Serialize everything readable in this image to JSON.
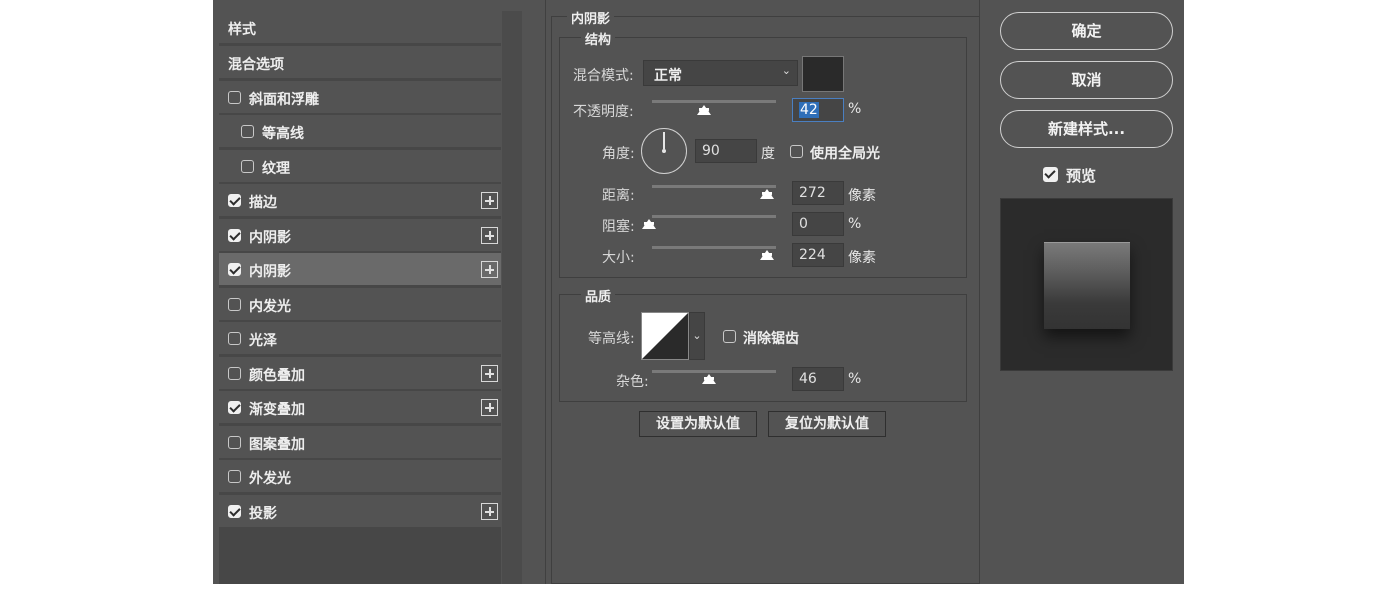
{
  "style_list": {
    "items": [
      {
        "label": "样式",
        "has_checkbox": false,
        "checked": false,
        "has_plus": false,
        "selected": false,
        "indent": false
      },
      {
        "label": "混合选项",
        "has_checkbox": false,
        "checked": false,
        "has_plus": false,
        "selected": false,
        "indent": false
      },
      {
        "label": "斜面和浮雕",
        "has_checkbox": true,
        "checked": false,
        "has_plus": false,
        "selected": false,
        "indent": false
      },
      {
        "label": "等高线",
        "has_checkbox": true,
        "checked": false,
        "has_plus": false,
        "selected": false,
        "indent": true
      },
      {
        "label": "纹理",
        "has_checkbox": true,
        "checked": false,
        "has_plus": false,
        "selected": false,
        "indent": true
      },
      {
        "label": "描边",
        "has_checkbox": true,
        "checked": true,
        "has_plus": true,
        "selected": false,
        "indent": false
      },
      {
        "label": "内阴影",
        "has_checkbox": true,
        "checked": true,
        "has_plus": true,
        "selected": false,
        "indent": false
      },
      {
        "label": "内阴影",
        "has_checkbox": true,
        "checked": true,
        "has_plus": true,
        "selected": true,
        "indent": false
      },
      {
        "label": "内发光",
        "has_checkbox": true,
        "checked": false,
        "has_plus": false,
        "selected": false,
        "indent": false
      },
      {
        "label": "光泽",
        "has_checkbox": true,
        "checked": false,
        "has_plus": false,
        "selected": false,
        "indent": false
      },
      {
        "label": "颜色叠加",
        "has_checkbox": true,
        "checked": false,
        "has_plus": true,
        "selected": false,
        "indent": false
      },
      {
        "label": "渐变叠加",
        "has_checkbox": true,
        "checked": true,
        "has_plus": true,
        "selected": false,
        "indent": false
      },
      {
        "label": "图案叠加",
        "has_checkbox": true,
        "checked": false,
        "has_plus": false,
        "selected": false,
        "indent": false
      },
      {
        "label": "外发光",
        "has_checkbox": true,
        "checked": false,
        "has_plus": false,
        "selected": false,
        "indent": false
      },
      {
        "label": "投影",
        "has_checkbox": true,
        "checked": true,
        "has_plus": true,
        "selected": false,
        "indent": false
      }
    ]
  },
  "panel": {
    "title": "内阴影",
    "structure": {
      "legend": "结构",
      "blend_mode_label": "混合模式:",
      "blend_mode_value": "正常",
      "shadow_color": "#2a2a2a",
      "opacity_label": "不透明度:",
      "opacity_value": "42",
      "opacity_unit": "%",
      "opacity_level": 0.42,
      "angle_label": "角度:",
      "angle_value": "90",
      "angle_unit": "度",
      "global_light_label": "使用全局光",
      "global_light_checked": false,
      "distance_label": "距离:",
      "distance_value": "272",
      "distance_unit": "像素",
      "choke_label": "阻塞:",
      "choke_value": "0",
      "choke_unit": "%",
      "size_label": "大小:",
      "size_value": "224",
      "size_unit": "像素"
    },
    "quality": {
      "legend": "品质",
      "contour_label": "等高线:",
      "anti_alias_label": "消除锯齿",
      "anti_alias_checked": false,
      "noise_label": "杂色:",
      "noise_value": "46",
      "noise_unit": "%",
      "noise_level": 0.46
    },
    "set_default_label": "设置为默认值",
    "reset_default_label": "复位为默认值"
  },
  "actions": {
    "ok_label": "确定",
    "cancel_label": "取消",
    "new_style_label": "新建样式...",
    "preview_label": "预览",
    "preview_checked": true
  },
  "colors": {
    "dialog_bg": "#535353",
    "selected_row": "#6a6a6a",
    "highlight": "#2f6fb9"
  }
}
